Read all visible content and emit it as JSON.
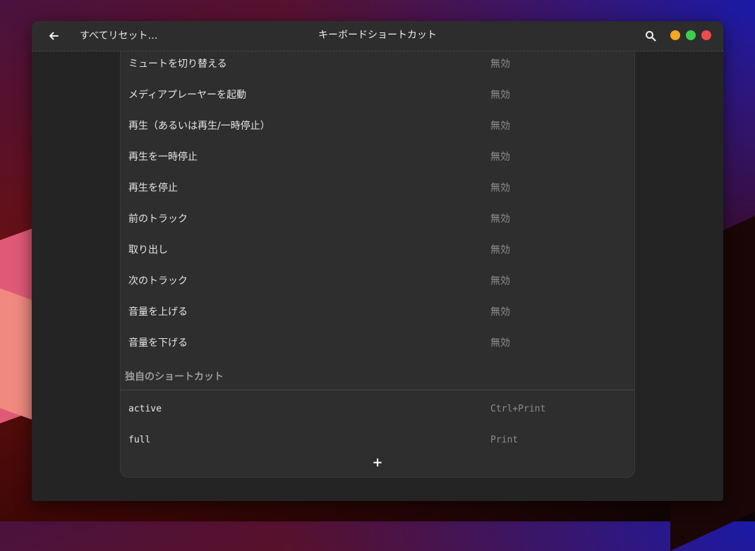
{
  "header": {
    "title": "キーボードショートカット",
    "reset_label": "すべてリセット…",
    "back_icon": "arrow-left-icon",
    "search_icon": "search-icon"
  },
  "window_controls": {
    "minimize_color": "#f5a623",
    "maximize_color": "#3ccf4e",
    "close_color": "#ed4c4c"
  },
  "shortcuts": [
    {
      "label": "ミュートを切り替える",
      "value": "無効"
    },
    {
      "label": "メディアプレーヤーを起動",
      "value": "無効"
    },
    {
      "label": "再生（あるいは再生/一時停止）",
      "value": "無効"
    },
    {
      "label": "再生を一時停止",
      "value": "無効"
    },
    {
      "label": "再生を停止",
      "value": "無効"
    },
    {
      "label": "前のトラック",
      "value": "無効"
    },
    {
      "label": "取り出し",
      "value": "無効"
    },
    {
      "label": "次のトラック",
      "value": "無効"
    },
    {
      "label": "音量を上げる",
      "value": "無効"
    },
    {
      "label": "音量を下げる",
      "value": "無効"
    }
  ],
  "custom_section": {
    "heading": "独自のショートカット",
    "items": [
      {
        "label": "active",
        "value": "Ctrl+Print"
      },
      {
        "label": "full",
        "value": "Print"
      }
    ],
    "add_label": "+"
  }
}
